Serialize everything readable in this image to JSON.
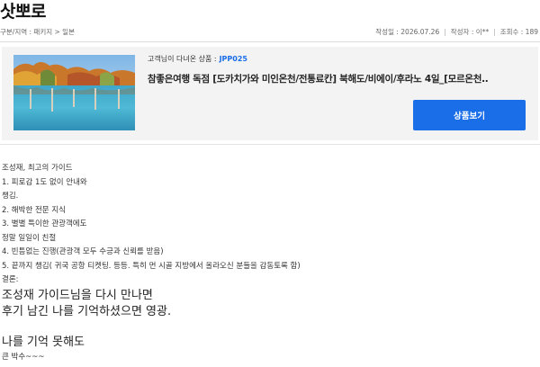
{
  "page": {
    "title": "삿뽀로"
  },
  "meta": {
    "breadcrumb": "구분/지역 : 패키지 > 일본",
    "date": "작성일 : 2026.07.26",
    "author": "작성자 : 이**",
    "views": "조회수 : 189"
  },
  "product": {
    "visited_label": "고객님이 다녀온 상품 :",
    "code": "JPP025",
    "name": "참좋은여행 독점 [도카치가와 미인온천/전통료칸] 북해도/비에이/후라노 4일_[모르온천..",
    "button_label": "상품보기",
    "image_icon": "lake-autumn-forest-photo"
  },
  "review": {
    "lines": [
      "조성재, 최고의 가이드",
      "1. 피로감 1도 없이 안내와",
      "챙김.",
      "2. 해박한 전문 지식",
      "3. 별별 특이한 관광객에도",
      "정말 일일이 친절",
      "4. 빈틈없는 진행(관광객 모두 수긍과 신뢰를 받음)",
      "5. 끝까지 챙김( 귀국 공항 티켓팅. 등등. 특히 먼 시골 지방에서 올라오신 분들을 감동토록 함)",
      "결론:"
    ],
    "big_lines": [
      "조성재 가이드님을 다시 만나면",
      "후기 남긴 나를 기억하셨으면 영광."
    ],
    "big_line_after": "나를 기억 못해도",
    "closing": "큰 박수~~~"
  },
  "colors": {
    "accent": "#1a6ee8",
    "panel": "#f3f3f3"
  }
}
